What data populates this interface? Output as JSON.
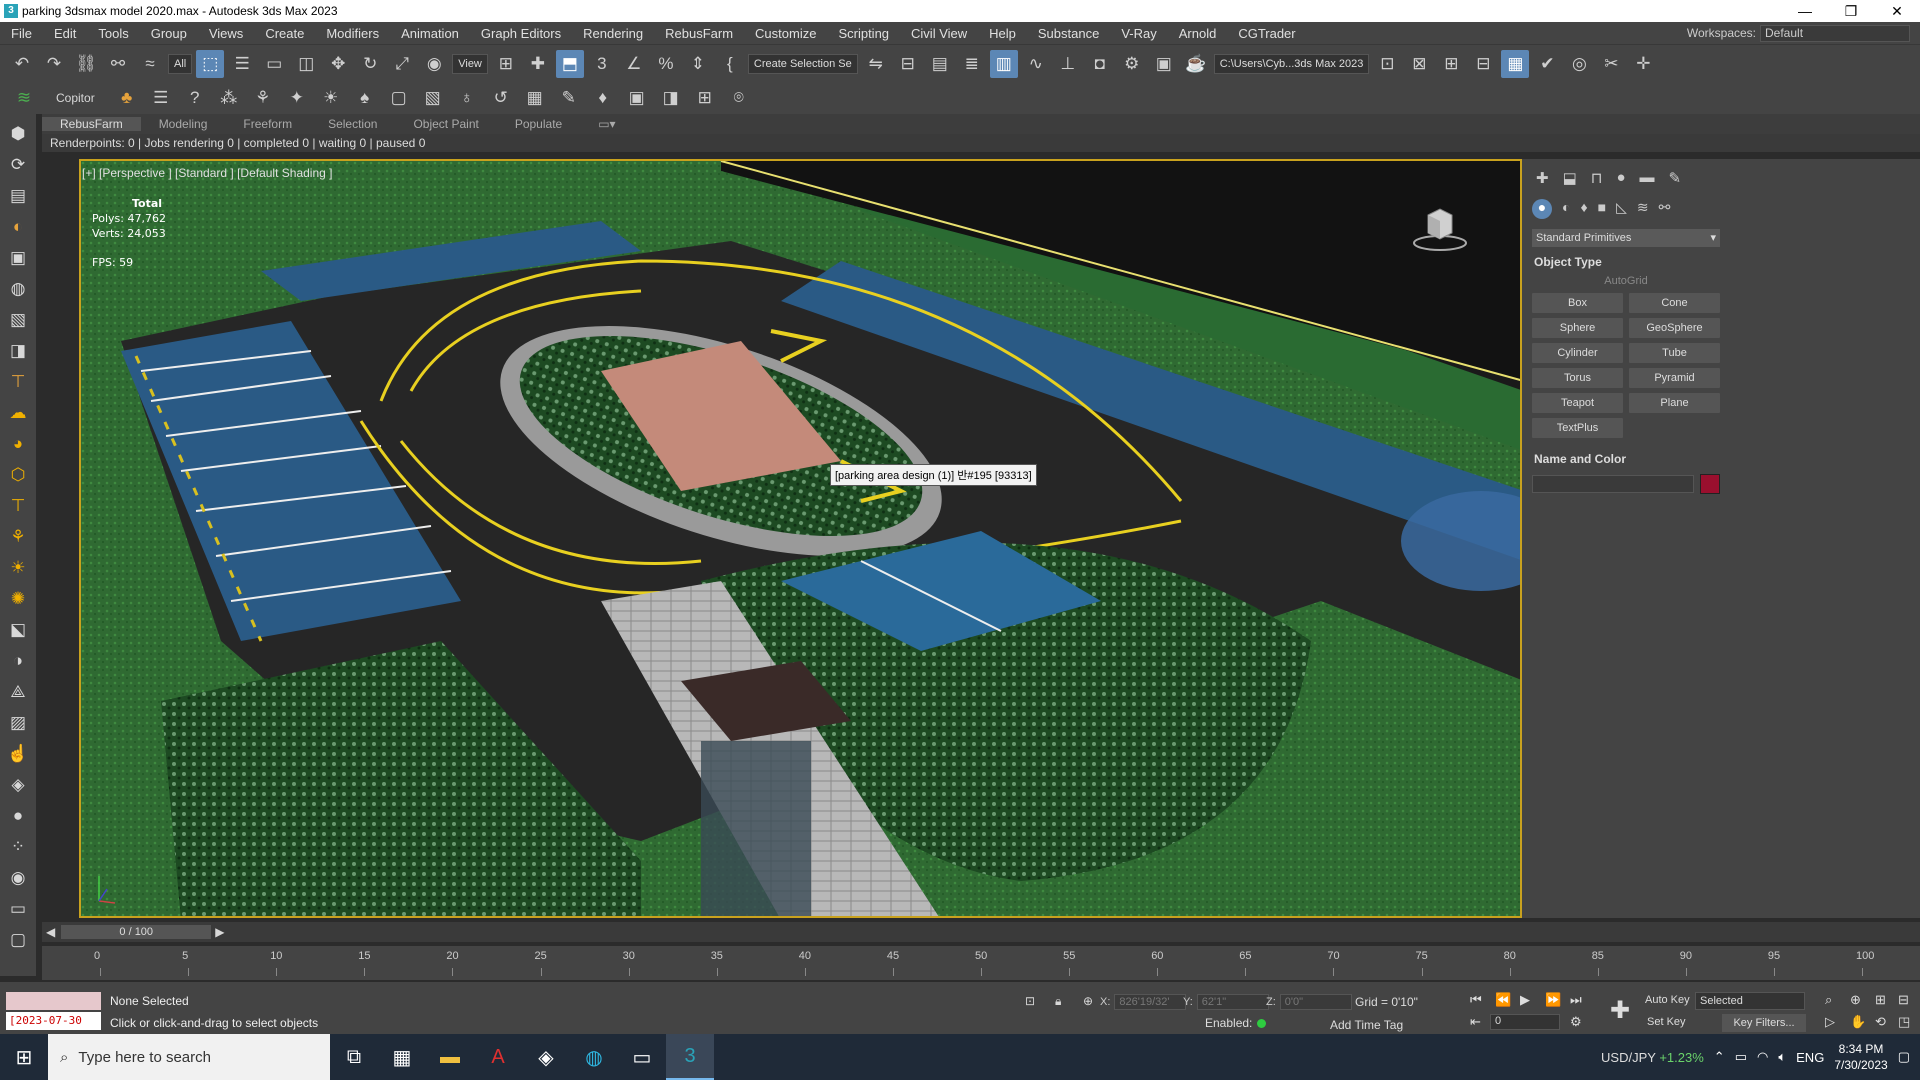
{
  "window": {
    "title": "parking 3dsmax model 2020.max - Autodesk 3ds Max 2023",
    "minimize": "—",
    "restore": "❐",
    "close": "✕"
  },
  "menu": [
    "File",
    "Edit",
    "Tools",
    "Group",
    "Views",
    "Create",
    "Modifiers",
    "Animation",
    "Graph Editors",
    "Rendering",
    "RebusFarm",
    "Customize",
    "Scripting",
    "Civil View",
    "Help",
    "Substance",
    "V-Ray",
    "Arnold",
    "CGTrader"
  ],
  "workspace": {
    "label": "Workspaces:",
    "value": "Default"
  },
  "toolbar": {
    "filter": "All",
    "ref_coord": "View",
    "selection_set": "Create Selection Se",
    "project_path": "C:\\Users\\Cyb...3ds Max 2023"
  },
  "toolbar2": {
    "copitor": "Copitor"
  },
  "ribbon": {
    "tabs": [
      "RebusFarm",
      "Modeling",
      "Freeform",
      "Selection",
      "Object Paint",
      "Populate"
    ]
  },
  "rebus_status": "Renderpoints: 0 | Jobs rendering 0 | completed 0 | waiting 0 | paused 0",
  "viewport": {
    "label": "[+] [Perspective ] [Standard ] [Default Shading ]",
    "stats_total": "Total",
    "polys": "Polys:  47,762",
    "verts": "Verts:  24,053",
    "fps": "FPS:     59",
    "tooltip": "[parking area design (1)] 반#195 [93313]"
  },
  "command_panel": {
    "dropdown": "Standard Primitives",
    "object_type_title": "Object Type",
    "autogrid": "AutoGrid",
    "primitives": [
      "Box",
      "Cone",
      "Sphere",
      "GeoSphere",
      "Cylinder",
      "Tube",
      "Torus",
      "Pyramid",
      "Teapot",
      "Plane",
      "TextPlus"
    ],
    "name_color_title": "Name and Color",
    "color": "#9a0f2e"
  },
  "timeline": {
    "frame": "0 / 100",
    "ticks": [
      "0",
      "5",
      "10",
      "15",
      "20",
      "25",
      "30",
      "35",
      "40",
      "45",
      "50",
      "55",
      "60",
      "65",
      "70",
      "75",
      "80",
      "85",
      "90",
      "95",
      "100"
    ]
  },
  "status": {
    "selection": "None Selected",
    "hint": "Click or click-and-drag to select objects",
    "date": "[2023-07-30",
    "x_label": "X:",
    "x_val": "826'19/32'",
    "y_label": "Y:",
    "y_val": "62'1\"",
    "z_label": "Z:",
    "z_val": "0'0\"",
    "grid": "Grid = 0'10\"",
    "enabled": "Enabled:",
    "add_time_tag": "Add Time Tag",
    "auto_key": "Auto Key",
    "set_key": "Set Key",
    "key_mode": "Selected",
    "key_filters": "Key Filters...",
    "frame_field": "0"
  },
  "taskbar": {
    "search_placeholder": "Type here to search",
    "fx": "USD/JPY",
    "fx_change": "+1.23%",
    "lang": "ENG",
    "time": "8:34 PM",
    "date": "7/30/2023"
  }
}
